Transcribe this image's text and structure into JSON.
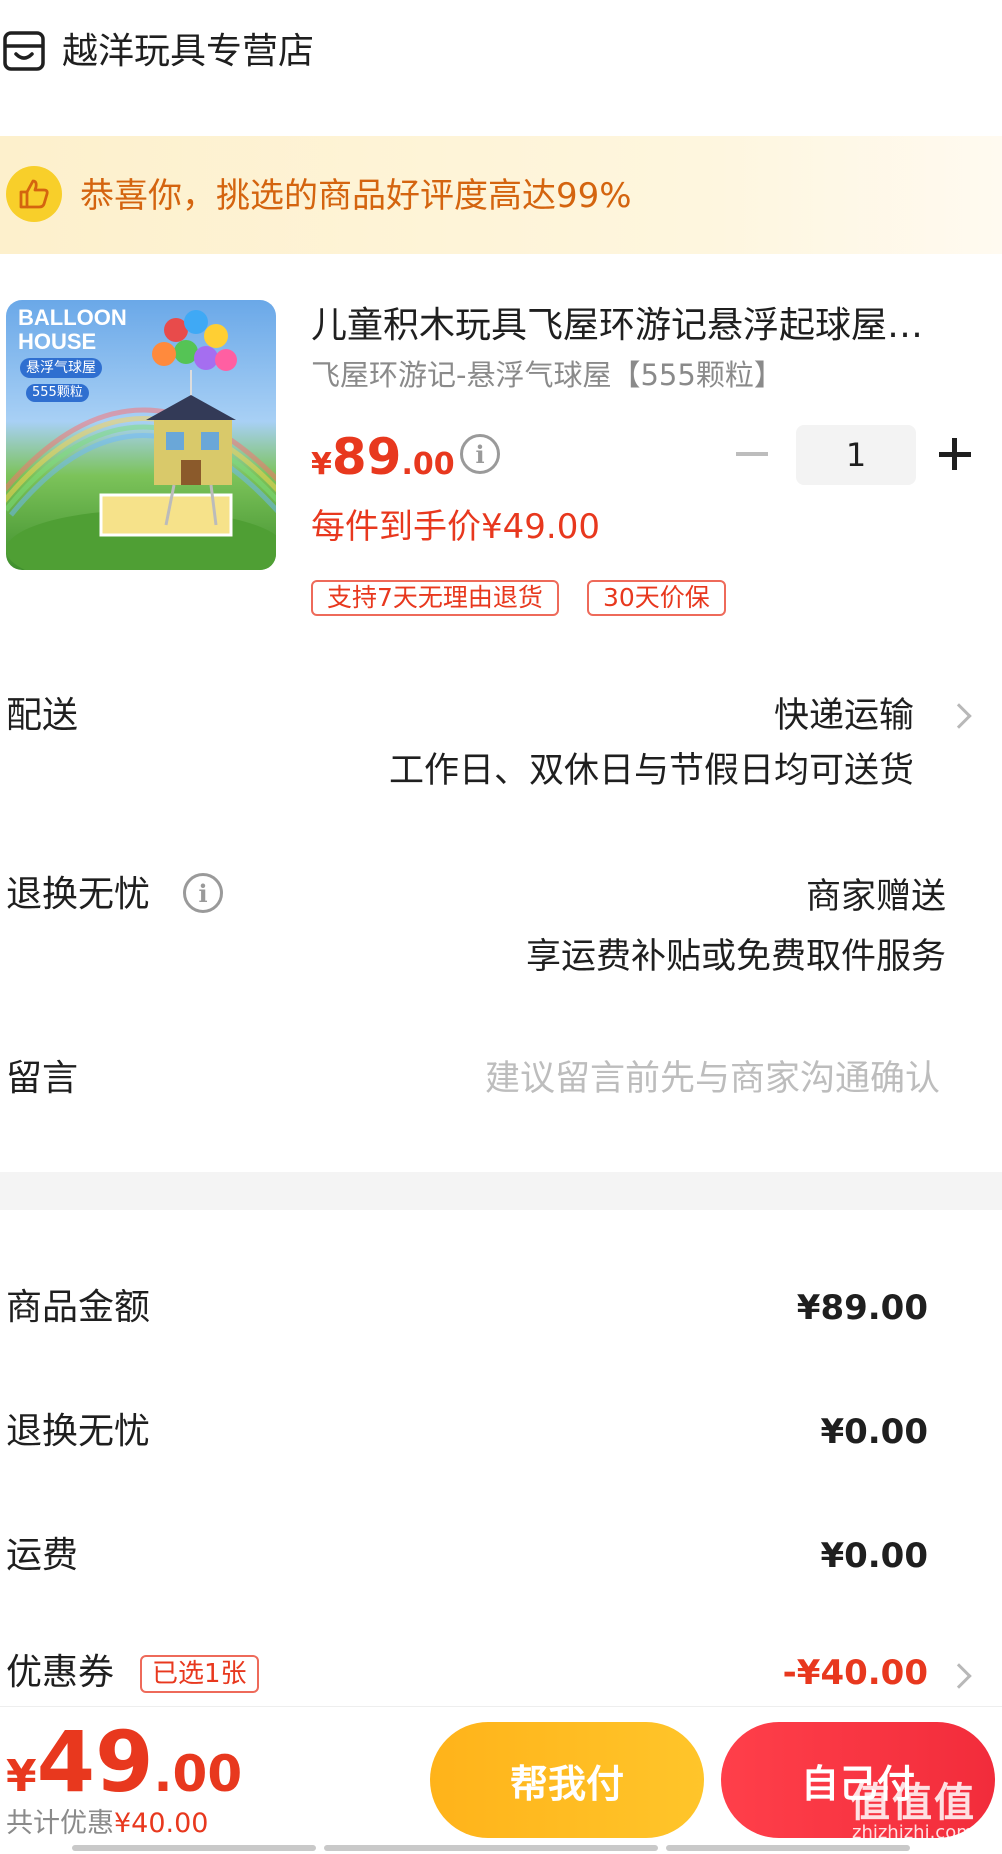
{
  "store": {
    "name": "越洋玩具专营店",
    "icon": "store-icon"
  },
  "banner": {
    "text": "恭喜你，挑选的商品好评度高达99%",
    "icon": "thumbs-up-icon"
  },
  "product": {
    "image_text": {
      "title1": "BALLOON",
      "title2": "HOUSE",
      "badge1": "悬浮气球屋",
      "badge2": "555颗粒"
    },
    "title": "儿童积木玩具飞屋环游记悬浮起球屋…",
    "spec": "飞屋环游记-悬浮气球屋【555颗粒】",
    "price": {
      "currency": "¥",
      "integer": "89",
      "decimal": ".00"
    },
    "quantity": "1",
    "unit_price": "每件到手价¥49.00",
    "tags": [
      "支持7天无理由退货",
      "30天价保"
    ]
  },
  "delivery": {
    "label": "配送",
    "method": "快递运输",
    "note": "工作日、双休日与节假日均可送货"
  },
  "return": {
    "label": "退换无忧",
    "value": "商家赠送",
    "note": "享运费补贴或免费取件服务"
  },
  "message": {
    "label": "留言",
    "placeholder": "建议留言前先与商家沟通确认"
  },
  "summary": {
    "goods_label": "商品金额",
    "goods_value": "¥89.00",
    "return_label": "退换无忧",
    "return_value": "¥0.00",
    "shipping_label": "运费",
    "shipping_value": "¥0.00",
    "coupon_label": "优惠券",
    "coupon_badge": "已选1张",
    "coupon_value": "-¥40.00"
  },
  "bottom": {
    "total": {
      "currency": "¥",
      "integer": "49",
      "decimal": ".00"
    },
    "saved_label": "共计优惠",
    "saved_value": "¥40.00",
    "help_pay": "帮我付",
    "self_pay": "自己付",
    "watermark": "值值值",
    "watermark_sub": "zhizhizhi.com"
  },
  "colors": {
    "accent": "#e8381e",
    "banner_text": "#d4640f",
    "help_button": "#ffb31a",
    "self_button": "#f22c3b"
  }
}
